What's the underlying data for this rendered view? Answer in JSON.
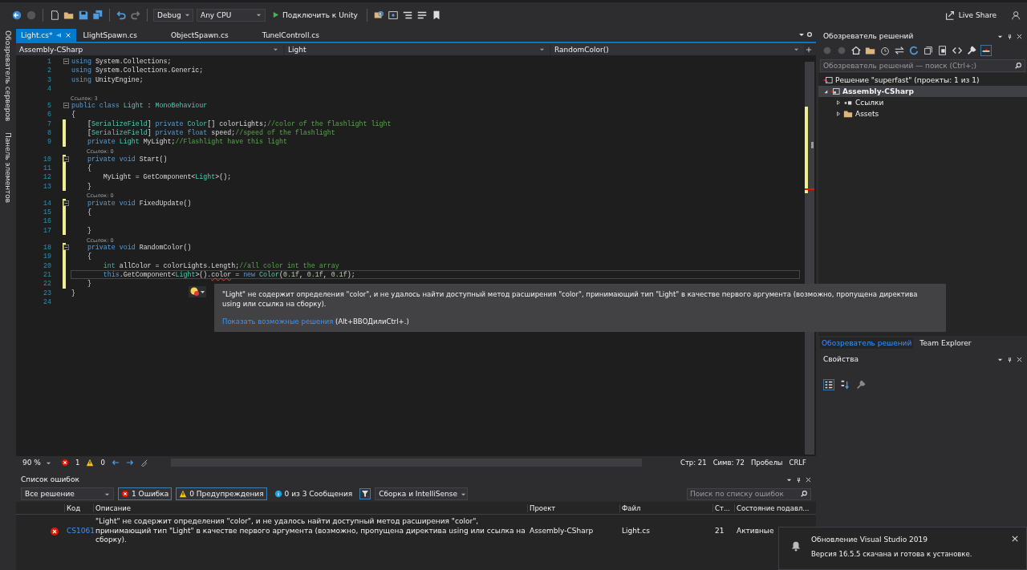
{
  "toolbar": {
    "configuration": "Debug",
    "platform": "Any CPU",
    "run_label": "Подключить к Unity",
    "live_share": "Live Share"
  },
  "side_strip": [
    "Обозреватель серверов",
    "Панель элементов"
  ],
  "tabs": [
    {
      "label": "Light.cs*",
      "selected": true
    },
    {
      "label": "LlightSpawn.cs",
      "selected": false
    },
    {
      "label": "ObjectSpawn.cs",
      "selected": false
    },
    {
      "label": "TunelControll.cs",
      "selected": false
    }
  ],
  "navigation": [
    "Assembly-CSharp",
    "Light",
    "RandomColor()"
  ],
  "code": [
    {
      "number": "1",
      "fold": true,
      "changed": false,
      "current": false,
      "tokens": [
        {
          "kind": "kw",
          "text": "using"
        },
        {
          "kind": "plain",
          "text": " System.Collections;"
        }
      ]
    },
    {
      "number": "2",
      "fold": false,
      "changed": false,
      "current": false,
      "tokens": [
        {
          "kind": "kw",
          "text": "using"
        },
        {
          "kind": "plain",
          "text": " System.Collections.Generic;"
        }
      ]
    },
    {
      "number": "3",
      "fold": false,
      "changed": false,
      "current": false,
      "tokens": [
        {
          "kind": "kw",
          "text": "using"
        },
        {
          "kind": "plain",
          "text": " UnityEngine;"
        }
      ]
    },
    {
      "number": "4",
      "fold": false,
      "changed": false,
      "current": false
    },
    {
      "number": "5",
      "fold": true,
      "changed": false,
      "current": false,
      "lens": "Ссылок: 3",
      "tokens": [
        {
          "kind": "kw",
          "text": "public class "
        },
        {
          "kind": "type",
          "text": "Light"
        },
        {
          "kind": "plain",
          "text": " : "
        },
        {
          "kind": "type",
          "text": "MonoBehaviour"
        }
      ]
    },
    {
      "number": "6",
      "fold": false,
      "changed": false,
      "current": false,
      "tokens": [
        {
          "kind": "plain",
          "text": "{"
        }
      ]
    },
    {
      "number": "7",
      "fold": false,
      "changed": true,
      "current": false,
      "tokens": [
        {
          "kind": "plain",
          "text": "    ["
        },
        {
          "kind": "type",
          "text": "SerializeField"
        },
        {
          "kind": "plain",
          "text": "] "
        },
        {
          "kind": "kw",
          "text": "private "
        },
        {
          "kind": "type",
          "text": "Color"
        },
        {
          "kind": "plain",
          "text": "[] colorLights;"
        },
        {
          "kind": "comment",
          "text": "//color of the flashlight light"
        }
      ]
    },
    {
      "number": "8",
      "fold": false,
      "changed": true,
      "current": false,
      "tokens": [
        {
          "kind": "plain",
          "text": "    ["
        },
        {
          "kind": "type",
          "text": "SerializeField"
        },
        {
          "kind": "plain",
          "text": "] "
        },
        {
          "kind": "kw",
          "text": "private float"
        },
        {
          "kind": "plain",
          "text": " speed;"
        },
        {
          "kind": "comment",
          "text": "//speed of the flashlight"
        }
      ]
    },
    {
      "number": "9",
      "fold": false,
      "changed": true,
      "current": false,
      "tokens": [
        {
          "kind": "kw",
          "text": "    private "
        },
        {
          "kind": "type",
          "text": "Light"
        },
        {
          "kind": "plain",
          "text": " MyLight;"
        },
        {
          "kind": "comment",
          "text": "//Flashlight have this light"
        }
      ]
    },
    {
      "number": "10",
      "fold": true,
      "changed": true,
      "current": false,
      "lens": "Ссылок: 0",
      "tokens": [
        {
          "kind": "kw",
          "text": "    private void"
        },
        {
          "kind": "plain",
          "text": " Start()"
        }
      ]
    },
    {
      "number": "11",
      "fold": false,
      "changed": true,
      "current": false,
      "tokens": [
        {
          "kind": "plain",
          "text": "    {"
        }
      ]
    },
    {
      "number": "12",
      "fold": false,
      "changed": true,
      "current": false,
      "tokens": [
        {
          "kind": "plain",
          "text": "        MyLight = GetComponent<"
        },
        {
          "kind": "type",
          "text": "Light"
        },
        {
          "kind": "plain",
          "text": ">();"
        }
      ]
    },
    {
      "number": "13",
      "fold": false,
      "changed": true,
      "current": false,
      "tokens": [
        {
          "kind": "plain",
          "text": "    }"
        }
      ]
    },
    {
      "number": "14",
      "fold": true,
      "changed": true,
      "current": false,
      "lens": "Ссылок: 0",
      "tokens": [
        {
          "kind": "kw",
          "text": "    private void"
        },
        {
          "kind": "plain",
          "text": " FixedUpdate()"
        }
      ]
    },
    {
      "number": "15",
      "fold": false,
      "changed": true,
      "current": false,
      "tokens": [
        {
          "kind": "plain",
          "text": "    {"
        }
      ]
    },
    {
      "number": "16",
      "fold": false,
      "changed": true,
      "current": false
    },
    {
      "number": "17",
      "fold": false,
      "changed": true,
      "current": false,
      "tokens": [
        {
          "kind": "plain",
          "text": "    }"
        }
      ]
    },
    {
      "number": "18",
      "fold": true,
      "changed": true,
      "current": false,
      "lens": "Ссылок: 0",
      "tokens": [
        {
          "kind": "kw",
          "text": "    private void"
        },
        {
          "kind": "plain",
          "text": " RandomColor()"
        }
      ]
    },
    {
      "number": "19",
      "fold": false,
      "changed": true,
      "current": false,
      "tokens": [
        {
          "kind": "plain",
          "text": "    {"
        }
      ]
    },
    {
      "number": "20",
      "fold": false,
      "changed": true,
      "current": false,
      "tokens": [
        {
          "kind": "kw",
          "text": "        int"
        },
        {
          "kind": "plain",
          "text": " allColor = colorLights.Length;"
        },
        {
          "kind": "comment",
          "text": "//all color int the array"
        }
      ]
    },
    {
      "number": "21",
      "fold": false,
      "changed": true,
      "current": true,
      "tokens": [
        {
          "kind": "kw",
          "text": "        this"
        },
        {
          "kind": "plain",
          "text": ".GetComponent<"
        },
        {
          "kind": "type",
          "text": "Light"
        },
        {
          "kind": "plain",
          "text": ">()."
        },
        {
          "kind": "error",
          "text": "color"
        },
        {
          "kind": "plain",
          "text": " = "
        },
        {
          "kind": "kw",
          "text": "new "
        },
        {
          "kind": "type",
          "text": "Color"
        },
        {
          "kind": "plain",
          "text": "("
        },
        {
          "kind": "num",
          "text": "0.1f"
        },
        {
          "kind": "plain",
          "text": ", "
        },
        {
          "kind": "num",
          "text": "0.1f"
        },
        {
          "kind": "plain",
          "text": ", "
        },
        {
          "kind": "num",
          "text": "0.1f"
        },
        {
          "kind": "plain",
          "text": ");"
        }
      ]
    },
    {
      "number": "22",
      "fold": false,
      "changed": true,
      "current": false,
      "tokens": [
        {
          "kind": "plain",
          "text": "    }"
        }
      ]
    },
    {
      "number": "23",
      "fold": false,
      "changed": false,
      "current": false,
      "tokens": [
        {
          "kind": "plain",
          "text": "}"
        }
      ]
    },
    {
      "number": "24",
      "fold": false,
      "changed": false,
      "current": false
    }
  ],
  "tooltip": {
    "message": "\"Light\" не содержит определения \"color\", и не удалось найти доступный метод расширения \"color\", принимающий тип \"Light\" в качестве первого аргумента (возможно, пропущена директива using или ссылка на сборку).",
    "link": "Показать возможные решения",
    "shortcut": "(Alt+ВВОДилиCtrl+.)"
  },
  "status": {
    "zoom": "90 %",
    "errors": "1",
    "warnings": "0",
    "line": "Стр: 21",
    "column": "Симв: 72",
    "indent": "Пробелы",
    "line_ending": "CRLF"
  },
  "error_list": {
    "title": "Список ошибок",
    "scope": "Все решение",
    "filters": [
      {
        "kind": "error",
        "label": "1 Ошибка",
        "selected": true
      },
      {
        "kind": "warning",
        "label": "0 Предупреждения",
        "selected": true
      },
      {
        "kind": "info",
        "label": "0 из 3 Сообщения",
        "selected": false
      }
    ],
    "source": "Сборка и IntelliSense",
    "search_placeholder": "Поиск по списку ошибок",
    "columns": [
      "Код",
      "Описание",
      "Проект",
      "Файл",
      "Ст...",
      "Состояние подавл..."
    ],
    "rows": [
      {
        "code": "CS1061",
        "description": "\"Light\" не содержит определения \"color\", и не удалось найти доступный метод расширения \"color\", принимающий тип \"Light\" в качестве первого аргумента (возможно, пропущена директива using или ссылка на сборку).",
        "project": "Assembly-CSharp",
        "file": "Light.cs",
        "line": "21",
        "state": "Активные"
      }
    ]
  },
  "solution_explorer": {
    "title": "Обозреватель решений",
    "search_placeholder": "Обозреватель решений — поиск (Ctrl+;)",
    "tree": [
      {
        "kind": "solution",
        "label": "Решение \"superfast\" (проекты: 1 из 1)",
        "children": [
          {
            "kind": "project",
            "label": "Assembly-CSharp",
            "expanded": true,
            "selected": true,
            "children": [
              {
                "kind": "references",
                "label": "Ссылки",
                "expanded": false,
                "selected": false
              },
              {
                "kind": "folder",
                "label": "Assets",
                "expanded": false,
                "selected": false
              }
            ]
          }
        ]
      }
    ]
  },
  "panel_tabs": [
    {
      "label": "Обозреватель решений",
      "selected": true
    },
    {
      "label": "Team Explorer",
      "selected": false
    }
  ],
  "properties": {
    "title": "Свойства"
  },
  "notification": {
    "title": "Обновление Visual Studio 2019",
    "text": "Версия 16.5.5 скачана и готова к установке."
  }
}
